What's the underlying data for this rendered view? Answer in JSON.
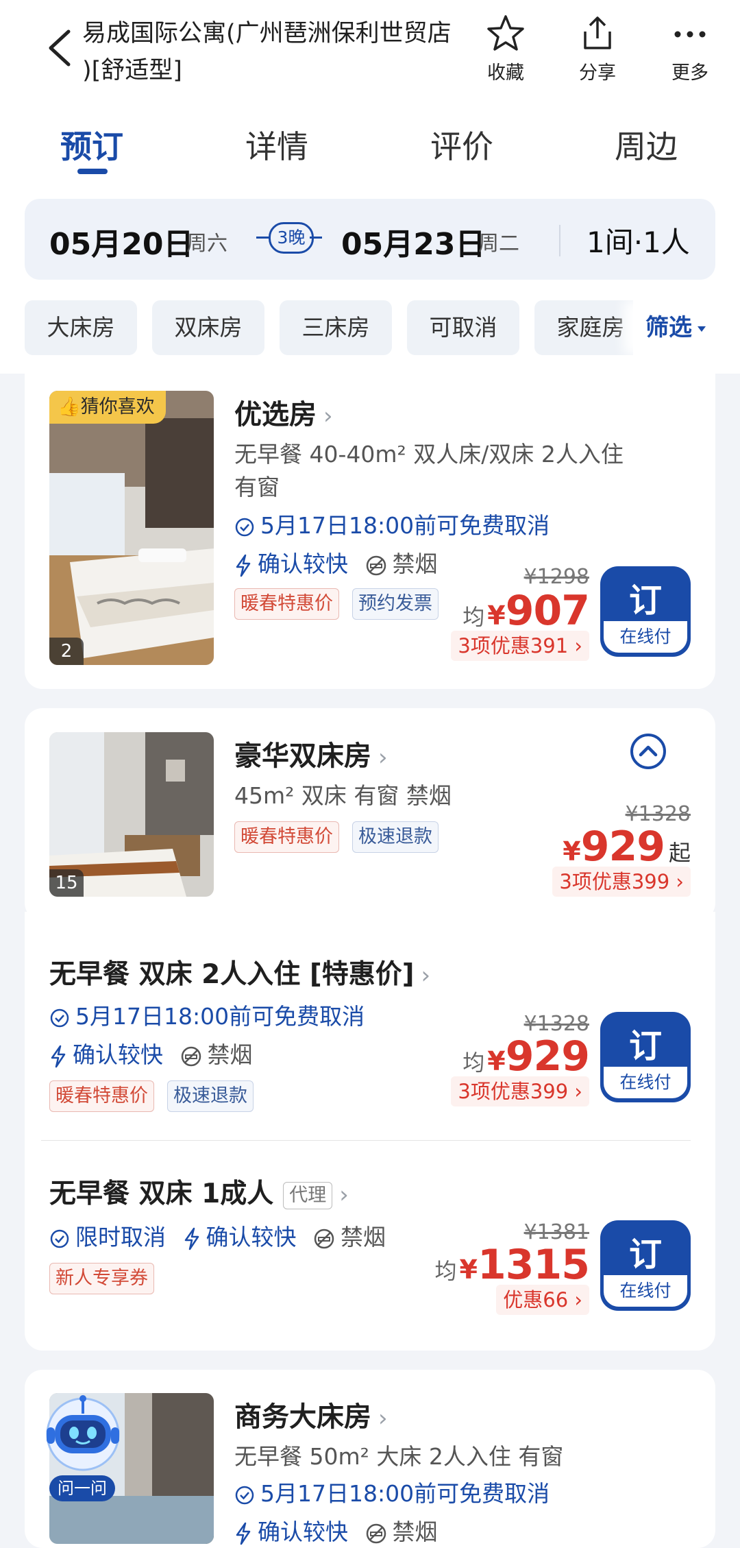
{
  "header": {
    "title_line1": "易成国际公寓(广州琶洲保利世贸店",
    "title_line2": ")[舒适型]",
    "actions": [
      {
        "label": "收藏",
        "icon": "star-icon"
      },
      {
        "label": "分享",
        "icon": "share-icon"
      },
      {
        "label": "更多",
        "icon": "more-icon"
      }
    ]
  },
  "tabs": [
    {
      "label": "预订",
      "active": true
    },
    {
      "label": "详情",
      "active": false
    },
    {
      "label": "评价",
      "active": false
    },
    {
      "label": "周边",
      "active": false
    }
  ],
  "datebar": {
    "checkin_date": "05月20日",
    "checkin_week": "周六",
    "nights": "3晚",
    "checkout_date": "05月23日",
    "checkout_week": "周二",
    "rooms_guests": "1间·1人"
  },
  "filters": {
    "chips": [
      "大床房",
      "双床房",
      "三床房",
      "可取消",
      "家庭房"
    ],
    "filter_label": "筛选"
  },
  "rooms": [
    {
      "badge": "猜你喜欢",
      "photo_count": "2",
      "name": "优选房",
      "desc_line1": "无早餐 40-40m² 双人床/双床 2人入住",
      "desc_line2": "有窗",
      "cancel": "5月17日18:00前可免费取消",
      "confirm": "确认较快",
      "smoke": "禁烟",
      "tags": [
        "暖春特惠价",
        "预约发票"
      ],
      "old_price": "¥1298",
      "avg_label": "均",
      "currency": "¥",
      "price": "907",
      "promo": "3项优惠391 ›",
      "book_label": "订",
      "book_sub": "在线付"
    },
    {
      "photo_count": "15",
      "name": "豪华双床房",
      "desc_line1": "45m² 双床 有窗 禁烟",
      "tags": [
        "暖春特惠价",
        "极速退款"
      ],
      "old_price": "¥1328",
      "currency": "¥",
      "price": "929",
      "price_suffix": "起",
      "promo": "3项优惠399 ›",
      "offers": [
        {
          "title": "无早餐 双床 2人入住 [特惠价]",
          "cancel": "5月17日18:00前可免费取消",
          "confirm": "确认较快",
          "smoke": "禁烟",
          "tags": [
            "暖春特惠价",
            "极速退款"
          ],
          "old_price": "¥1328",
          "avg_label": "均",
          "currency": "¥",
          "price": "929",
          "promo": "3项优惠399 ›",
          "book_label": "订",
          "book_sub": "在线付"
        },
        {
          "title": "无早餐 双床 1成人",
          "agent_tag": "代理",
          "cancel": "限时取消",
          "confirm": "确认较快",
          "smoke": "禁烟",
          "tags": [
            "新人专享券"
          ],
          "old_price": "¥1381",
          "avg_label": "均",
          "currency": "¥",
          "price": "1315",
          "promo": "优惠66 ›",
          "book_label": "订",
          "book_sub": "在线付"
        }
      ]
    },
    {
      "name": "商务大床房",
      "desc_line1": "无早餐 50m² 大床 2人入住 有窗",
      "cancel": "5月17日18:00前可免费取消",
      "confirm": "确认较快",
      "smoke": "禁烟"
    }
  ],
  "assistant": {
    "label": "问一问",
    "icon": "robot-icon"
  },
  "colors": {
    "brand_blue": "#1a4ba8",
    "price_red": "#d9362c",
    "badge_yellow": "#f4c64a"
  }
}
